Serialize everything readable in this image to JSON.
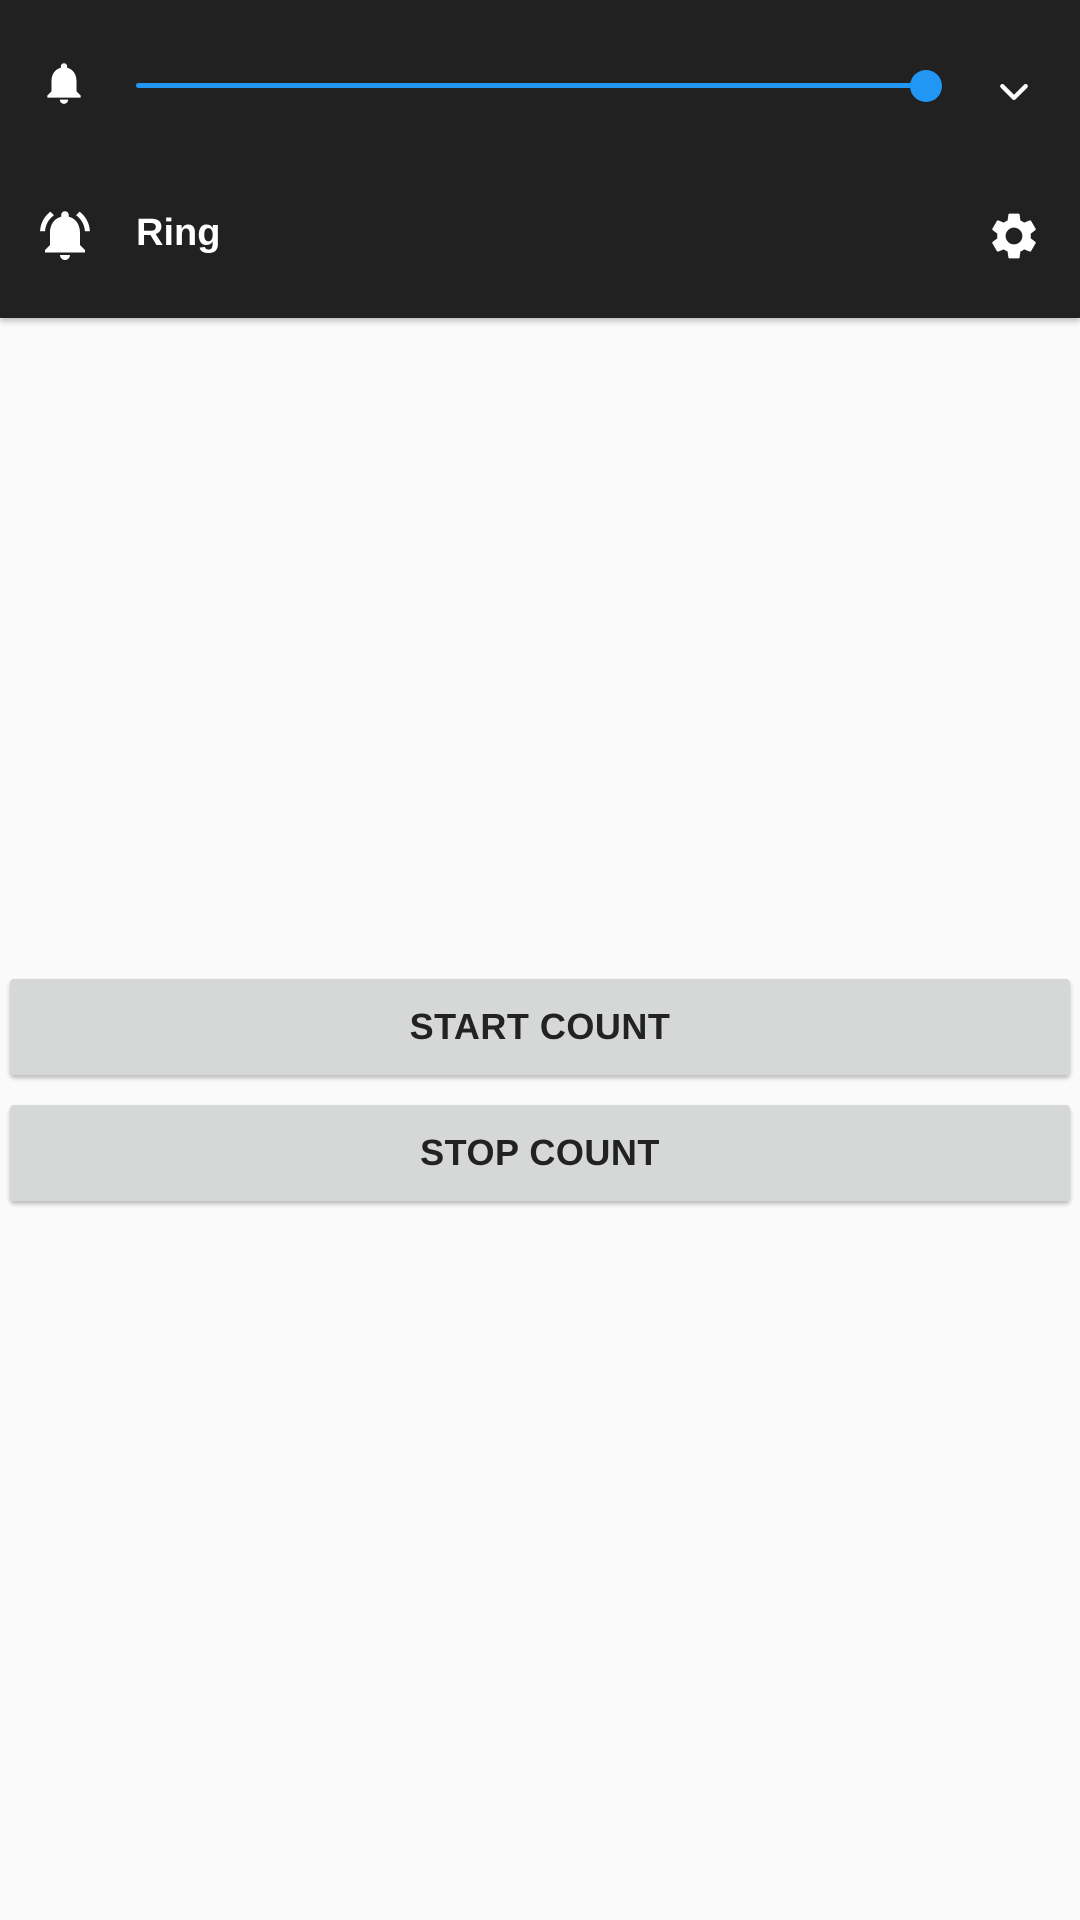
{
  "volume_panel": {
    "slider": {
      "icon": "bell-icon",
      "value_fraction": 1.0,
      "accent_color": "#2196f3"
    },
    "expand_icon": "chevron-down-icon",
    "mode": {
      "icon": "bell-ringing-icon",
      "label": "Ring",
      "settings_icon": "gear-icon"
    },
    "background_color": "#212121"
  },
  "main": {
    "start_button_label": "START COUNT",
    "stop_button_label": "STOP COUNT"
  }
}
